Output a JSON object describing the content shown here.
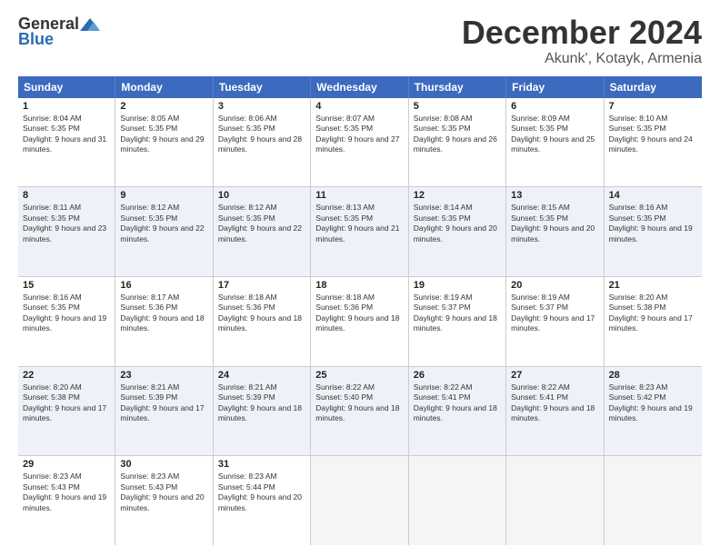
{
  "logo": {
    "general": "General",
    "blue": "Blue"
  },
  "title": "December 2024",
  "subtitle": "Akunk', Kotayk, Armenia",
  "header_days": [
    "Sunday",
    "Monday",
    "Tuesday",
    "Wednesday",
    "Thursday",
    "Friday",
    "Saturday"
  ],
  "weeks": [
    [
      {
        "day": "1",
        "sunrise": "8:04 AM",
        "sunset": "5:35 PM",
        "daylight": "9 hours and 31 minutes."
      },
      {
        "day": "2",
        "sunrise": "8:05 AM",
        "sunset": "5:35 PM",
        "daylight": "9 hours and 29 minutes."
      },
      {
        "day": "3",
        "sunrise": "8:06 AM",
        "sunset": "5:35 PM",
        "daylight": "9 hours and 28 minutes."
      },
      {
        "day": "4",
        "sunrise": "8:07 AM",
        "sunset": "5:35 PM",
        "daylight": "9 hours and 27 minutes."
      },
      {
        "day": "5",
        "sunrise": "8:08 AM",
        "sunset": "5:35 PM",
        "daylight": "9 hours and 26 minutes."
      },
      {
        "day": "6",
        "sunrise": "8:09 AM",
        "sunset": "5:35 PM",
        "daylight": "9 hours and 25 minutes."
      },
      {
        "day": "7",
        "sunrise": "8:10 AM",
        "sunset": "5:35 PM",
        "daylight": "9 hours and 24 minutes."
      }
    ],
    [
      {
        "day": "8",
        "sunrise": "8:11 AM",
        "sunset": "5:35 PM",
        "daylight": "9 hours and 23 minutes."
      },
      {
        "day": "9",
        "sunrise": "8:12 AM",
        "sunset": "5:35 PM",
        "daylight": "9 hours and 22 minutes."
      },
      {
        "day": "10",
        "sunrise": "8:12 AM",
        "sunset": "5:35 PM",
        "daylight": "9 hours and 22 minutes."
      },
      {
        "day": "11",
        "sunrise": "8:13 AM",
        "sunset": "5:35 PM",
        "daylight": "9 hours and 21 minutes."
      },
      {
        "day": "12",
        "sunrise": "8:14 AM",
        "sunset": "5:35 PM",
        "daylight": "9 hours and 20 minutes."
      },
      {
        "day": "13",
        "sunrise": "8:15 AM",
        "sunset": "5:35 PM",
        "daylight": "9 hours and 20 minutes."
      },
      {
        "day": "14",
        "sunrise": "8:16 AM",
        "sunset": "5:35 PM",
        "daylight": "9 hours and 19 minutes."
      }
    ],
    [
      {
        "day": "15",
        "sunrise": "8:16 AM",
        "sunset": "5:35 PM",
        "daylight": "9 hours and 19 minutes."
      },
      {
        "day": "16",
        "sunrise": "8:17 AM",
        "sunset": "5:36 PM",
        "daylight": "9 hours and 18 minutes."
      },
      {
        "day": "17",
        "sunrise": "8:18 AM",
        "sunset": "5:36 PM",
        "daylight": "9 hours and 18 minutes."
      },
      {
        "day": "18",
        "sunrise": "8:18 AM",
        "sunset": "5:36 PM",
        "daylight": "9 hours and 18 minutes."
      },
      {
        "day": "19",
        "sunrise": "8:19 AM",
        "sunset": "5:37 PM",
        "daylight": "9 hours and 18 minutes."
      },
      {
        "day": "20",
        "sunrise": "8:19 AM",
        "sunset": "5:37 PM",
        "daylight": "9 hours and 17 minutes."
      },
      {
        "day": "21",
        "sunrise": "8:20 AM",
        "sunset": "5:38 PM",
        "daylight": "9 hours and 17 minutes."
      }
    ],
    [
      {
        "day": "22",
        "sunrise": "8:20 AM",
        "sunset": "5:38 PM",
        "daylight": "9 hours and 17 minutes."
      },
      {
        "day": "23",
        "sunrise": "8:21 AM",
        "sunset": "5:39 PM",
        "daylight": "9 hours and 17 minutes."
      },
      {
        "day": "24",
        "sunrise": "8:21 AM",
        "sunset": "5:39 PM",
        "daylight": "9 hours and 18 minutes."
      },
      {
        "day": "25",
        "sunrise": "8:22 AM",
        "sunset": "5:40 PM",
        "daylight": "9 hours and 18 minutes."
      },
      {
        "day": "26",
        "sunrise": "8:22 AM",
        "sunset": "5:41 PM",
        "daylight": "9 hours and 18 minutes."
      },
      {
        "day": "27",
        "sunrise": "8:22 AM",
        "sunset": "5:41 PM",
        "daylight": "9 hours and 18 minutes."
      },
      {
        "day": "28",
        "sunrise": "8:23 AM",
        "sunset": "5:42 PM",
        "daylight": "9 hours and 19 minutes."
      }
    ],
    [
      {
        "day": "29",
        "sunrise": "8:23 AM",
        "sunset": "5:43 PM",
        "daylight": "9 hours and 19 minutes."
      },
      {
        "day": "30",
        "sunrise": "8:23 AM",
        "sunset": "5:43 PM",
        "daylight": "9 hours and 20 minutes."
      },
      {
        "day": "31",
        "sunrise": "8:23 AM",
        "sunset": "5:44 PM",
        "daylight": "9 hours and 20 minutes."
      },
      null,
      null,
      null,
      null
    ]
  ]
}
